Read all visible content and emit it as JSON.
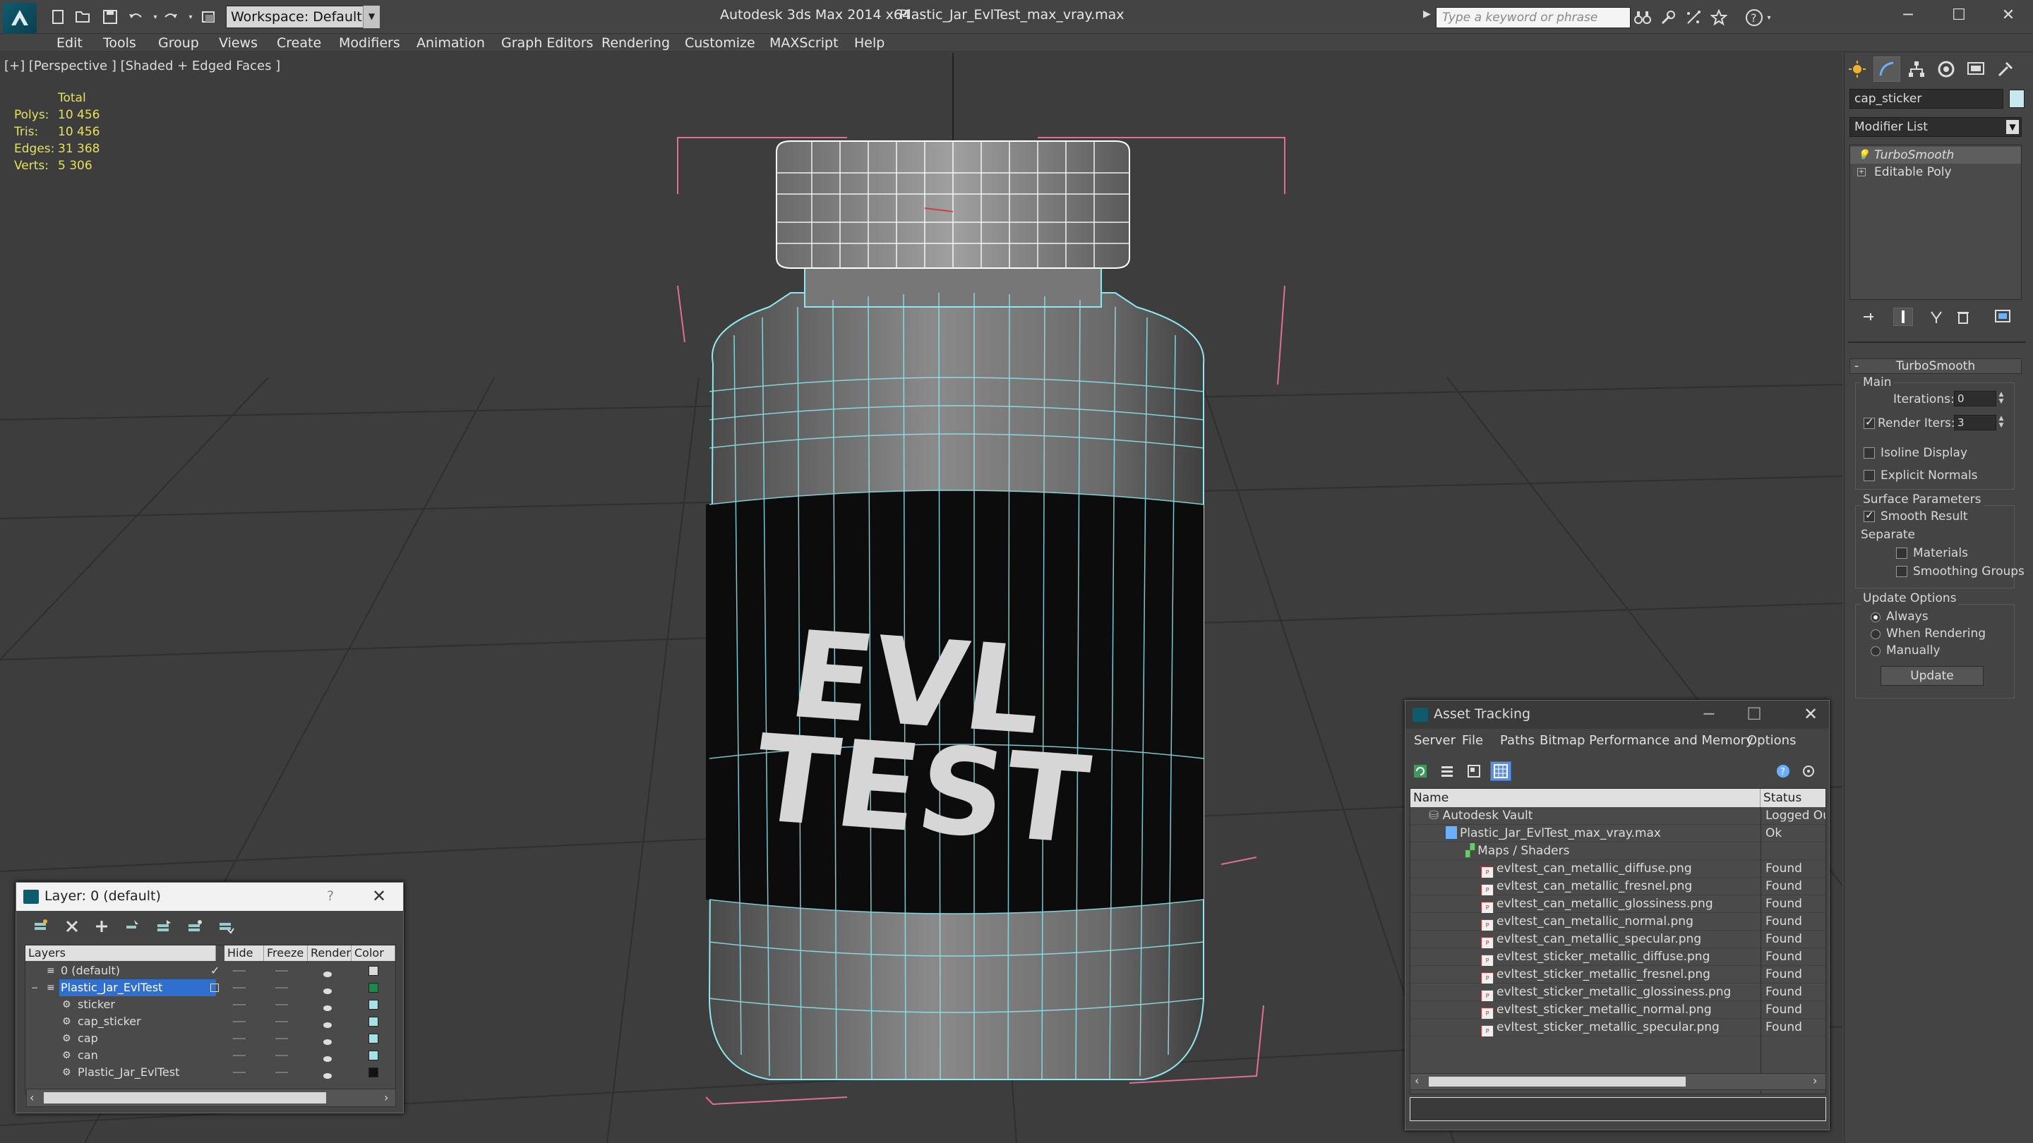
{
  "titlebar": {
    "workspace_label": "Workspace: Default",
    "app_title": "Autodesk 3ds Max  2014 x64",
    "file_title": "Plastic_Jar_EvlTest_max_vray.max",
    "search_placeholder": "Type a keyword or phrase"
  },
  "menu": [
    "Edit",
    "Tools",
    "Group",
    "Views",
    "Create",
    "Modifiers",
    "Animation",
    "Graph Editors",
    "Rendering",
    "Customize",
    "MAXScript",
    "Help"
  ],
  "viewport": {
    "label": "[+] [Perspective ] [Shaded + Edged Faces ]",
    "stats_header": "Total",
    "stats": [
      {
        "label": "Polys:",
        "value": "10 456"
      },
      {
        "label": "Tris:",
        "value": "10 456"
      },
      {
        "label": "Edges:",
        "value": "31 368"
      },
      {
        "label": "Verts:",
        "value": "5 306"
      }
    ],
    "label_line1": "EVL",
    "label_line2": "TEST"
  },
  "command_panel": {
    "object_name": "cap_sticker",
    "modifier_list": "Modifier List",
    "stack": [
      "TurboSmooth",
      "Editable Poly"
    ],
    "rollout_title": "TurboSmooth",
    "main_label": "Main",
    "iterations_label": "Iterations:",
    "iterations_value": "0",
    "render_iters_label": "Render Iters:",
    "render_iters_value": "3",
    "isoline_label": "Isoline Display",
    "explicit_normals_label": "Explicit Normals",
    "surface_params_label": "Surface Parameters",
    "smooth_result_label": "Smooth Result",
    "separate_label": "Separate",
    "materials_label": "Materials",
    "smoothing_groups_label": "Smoothing Groups",
    "update_options_label": "Update Options",
    "always_label": "Always",
    "when_rendering_label": "When Rendering",
    "manually_label": "Manually",
    "update_button": "Update"
  },
  "layer_window": {
    "title": "Layer: 0 (default)",
    "help": "?",
    "columns": [
      "Layers",
      "Hide",
      "Freeze",
      "Render",
      "Color"
    ],
    "rows": [
      {
        "name": "0 (default)",
        "color": "#d8d8d8"
      },
      {
        "name": "Plastic_Jar_EvlTest",
        "color": "#1a8a4a"
      },
      {
        "name": "sticker",
        "color": "#a8e0e8"
      },
      {
        "name": "cap_sticker",
        "color": "#a8e0e8"
      },
      {
        "name": "cap",
        "color": "#a8e0e8"
      },
      {
        "name": "can",
        "color": "#a8e0e8"
      },
      {
        "name": "Plastic_Jar_EvlTest",
        "color": "#111111"
      }
    ]
  },
  "asset_window": {
    "title": "Asset Tracking",
    "menu": [
      "Server",
      "File",
      "Paths",
      "Bitmap Performance and Memory",
      "Options"
    ],
    "columns": [
      "Name",
      "Status"
    ],
    "rows": [
      {
        "name": "Autodesk Vault",
        "status": "Logged Out",
        "level": 0
      },
      {
        "name": "Plastic_Jar_EvlTest_max_vray.max",
        "status": "Ok",
        "level": 1
      },
      {
        "name": "Maps / Shaders",
        "status": "",
        "level": 2
      },
      {
        "name": "evltest_can_metallic_diffuse.png",
        "status": "Found",
        "level": 3
      },
      {
        "name": "evltest_can_metallic_fresnel.png",
        "status": "Found",
        "level": 3
      },
      {
        "name": "evltest_can_metallic_glossiness.png",
        "status": "Found",
        "level": 3
      },
      {
        "name": "evltest_can_metallic_normal.png",
        "status": "Found",
        "level": 3
      },
      {
        "name": "evltest_can_metallic_specular.png",
        "status": "Found",
        "level": 3
      },
      {
        "name": "evltest_sticker_metallic_diffuse.png",
        "status": "Found",
        "level": 3
      },
      {
        "name": "evltest_sticker_metallic_fresnel.png",
        "status": "Found",
        "level": 3
      },
      {
        "name": "evltest_sticker_metallic_glossiness.png",
        "status": "Found",
        "level": 3
      },
      {
        "name": "evltest_sticker_metallic_normal.png",
        "status": "Found",
        "level": 3
      },
      {
        "name": "evltest_sticker_metallic_specular.png",
        "status": "Found",
        "level": 3
      }
    ]
  },
  "colors": {
    "accent": "#2f6fd0",
    "wire": "#8fe8f0",
    "selection_bracket": "#e07090",
    "stats_yellow": "#e6e060"
  }
}
